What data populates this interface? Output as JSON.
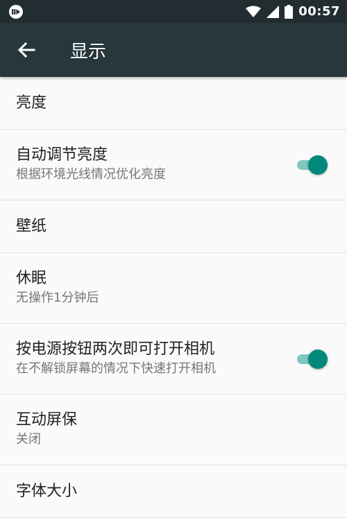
{
  "status_bar": {
    "time": "00:57",
    "icons": [
      "cast-notification-icon",
      "wifi-icon",
      "signal-icon",
      "battery-icon"
    ]
  },
  "app_bar": {
    "title": "显示",
    "back_icon": "arrow-back-icon"
  },
  "settings": [
    {
      "title": "亮度"
    },
    {
      "title": "自动调节亮度",
      "subtitle": "根据环境光线情况优化亮度",
      "toggle_on": true
    },
    {
      "title": "壁纸"
    },
    {
      "title": "休眠",
      "subtitle": "无操作1分钟后"
    },
    {
      "title": "按电源按钮两次即可打开相机",
      "subtitle": "在不解锁屏幕的情况下快速打开相机",
      "toggle_on": true
    },
    {
      "title": "互动屏保",
      "subtitle": "关闭"
    },
    {
      "title": "字体大小"
    }
  ],
  "colors": {
    "status_bar": "#222d31",
    "app_bar": "#27373c",
    "accent": "#00897b",
    "accent_track": "#7fc7bf",
    "background": "#fafafa"
  }
}
